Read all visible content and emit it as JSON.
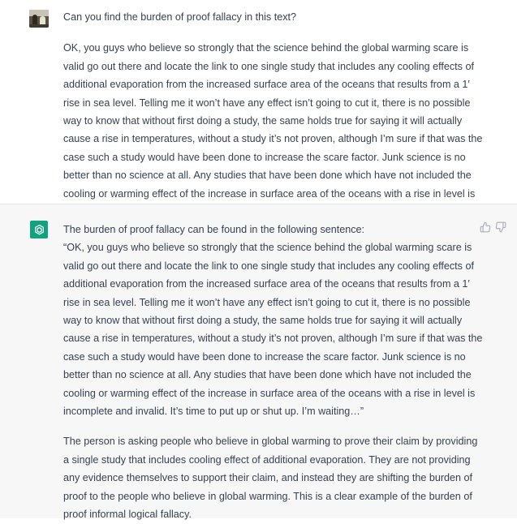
{
  "user_message": {
    "question": "Can you find the burden of proof fallacy in this text?",
    "body": "OK, you guys who believe so strongly that the science behind the global warming scare is valid go out there and locate the link to one single study that includes any cooling effects of additional evaporation from the increased surface area of the oceans that results from a 1′ rise in sea level. Telling me it won’t have any effect isn’t going to cut it, there is no possible way to know that without first doing a study, the same holds true for saying it will actually cause a rise in temperatures, without a study it’s not proven, although I’m sure if that was the case such a study would have been done to increase the scare factor. Junk science is no better than no science at all. Any studies that have been done which have not included the cooling or warming effect of the increase in surface area of the oceans with a rise in level is incomplete and invalid. It’s time to put up or shut up. I’m waiting…"
  },
  "assistant_message": {
    "intro": "The burden of proof fallacy can be found in the following sentence:",
    "quote": "“OK, you guys who believe so strongly that the science behind the global warming scare is valid go out there and locate the link to one single study that includes any cooling effects of additional evaporation from the increased surface area of the oceans that results from a 1′ rise in sea level. Telling me it won’t have any effect isn’t going to cut it, there is no possible way to know that without first doing a study, the same holds true for saying it will actually cause a rise in temperatures, without a study it’s not proven, although I’m sure if that was the case such a study would have been done to increase the scare factor. Junk science is no better than no science at all. Any studies that have been done which have not included the cooling or warming effect of the increase in surface area of the oceans with a rise in level is incomplete and invalid. It’s time to put up or shut up. I’m waiting…”",
    "explanation": "The person is asking people who believe in global warming to prove their claim by providing a single study that includes cooling effect of additional evaporation. They are not providing any evidence themselves to support their claim, and instead they are shifting the burden of proof to the people who believe in global warming. This is a clear example of the burden of proof informal logical fallacy."
  },
  "icons": {
    "user_avatar": "user-photo-avatar",
    "assistant_avatar": "openai-logo-icon",
    "feedback_up": "thumbs-up-icon",
    "feedback_down": "thumbs-down-icon"
  },
  "colors": {
    "assistant_bg": "#f7f7f8",
    "brand": "#10a37f",
    "text": "#374151",
    "icon": "#acacbe"
  }
}
